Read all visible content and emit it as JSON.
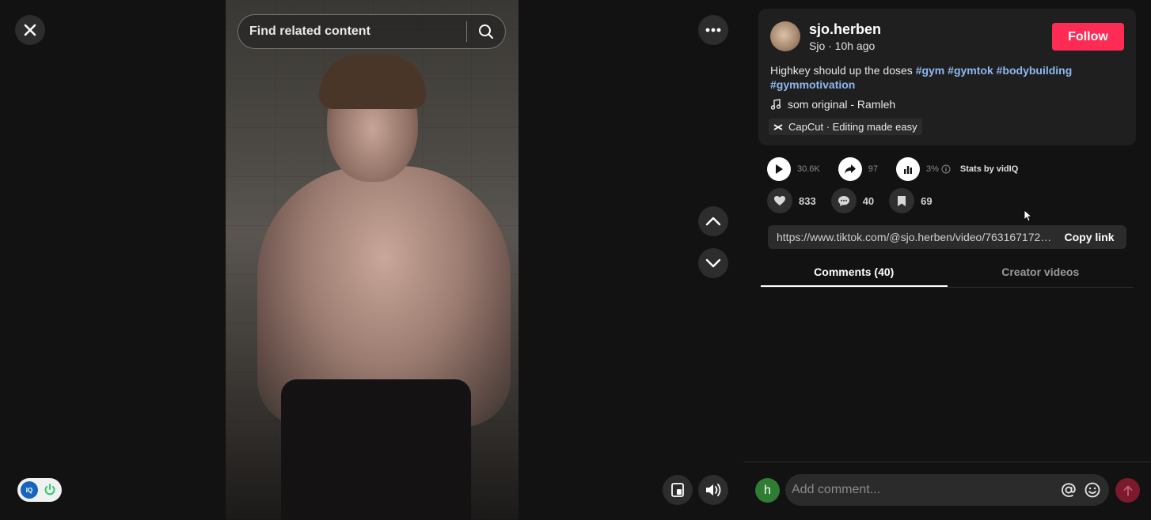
{
  "player": {
    "search_placeholder": "Find related content",
    "close_icon": "close-icon",
    "more_icon": "more-dots-icon",
    "prev_icon": "chevron-up-icon",
    "next_icon": "chevron-down-icon",
    "pip_icon": "floating-player-icon",
    "volume_icon": "volume-icon",
    "extension_logo": "IQ"
  },
  "creator": {
    "username": "sjo.herben",
    "subline": "Sjo · 10h ago",
    "follow_label": "Follow",
    "avatar": "avatar-image"
  },
  "post": {
    "caption_text": "Highkey should up the doses ",
    "hashtags": [
      "#gym",
      "#gymtok",
      "#bodybuilding",
      "#gymmotivation"
    ],
    "music": "som original - Ramleh",
    "capcut": "CapCut · Editing made easy"
  },
  "stats": {
    "views": "30.6K",
    "shares": "97",
    "engagement": "3%",
    "by": "Stats by vidIQ"
  },
  "actions": {
    "likes": "833",
    "comments": "40",
    "saves": "69"
  },
  "link": {
    "url": "https://www.tiktok.com/@sjo.herben/video/7631671728...",
    "copy_label": "Copy link"
  },
  "tabs": [
    {
      "label": "Comments (40)",
      "active": true
    },
    {
      "label": "Creator videos",
      "active": false
    }
  ],
  "comment_box": {
    "avatar_letter": "h",
    "placeholder": "Add comment..."
  },
  "colors": {
    "follow": "#fe2c55",
    "hashtag": "#8fb8f0",
    "background": "#121212"
  }
}
